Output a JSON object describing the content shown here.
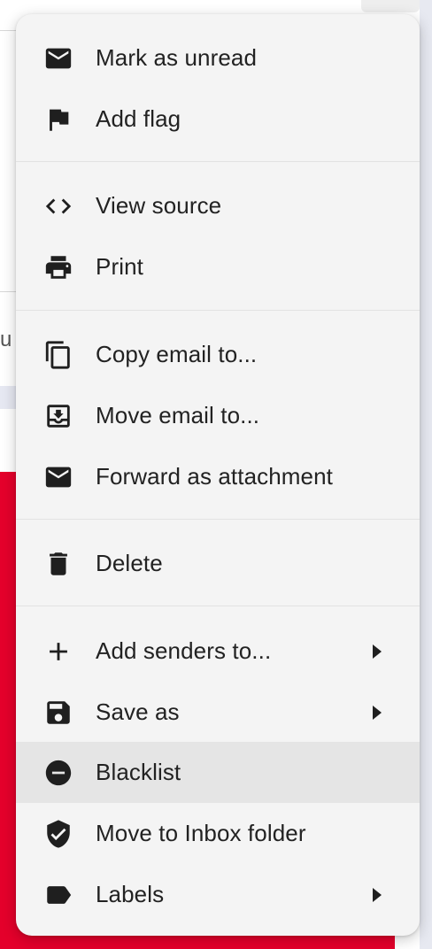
{
  "menu": {
    "mark_unread": "Mark as unread",
    "add_flag": "Add flag",
    "view_source": "View source",
    "print": "Print",
    "copy_email": "Copy email to...",
    "move_email": "Move email to...",
    "forward_attachment": "Forward as attachment",
    "delete": "Delete",
    "add_senders": "Add senders to...",
    "save_as": "Save as",
    "blacklist": "Blacklist",
    "move_inbox": "Move to Inbox folder",
    "labels": "Labels"
  },
  "background": {
    "partial_letter": "u"
  },
  "colors": {
    "background_banner": "#e4002b",
    "menu_bg": "#f4f4f4",
    "highlight": "#e5e5e5"
  }
}
